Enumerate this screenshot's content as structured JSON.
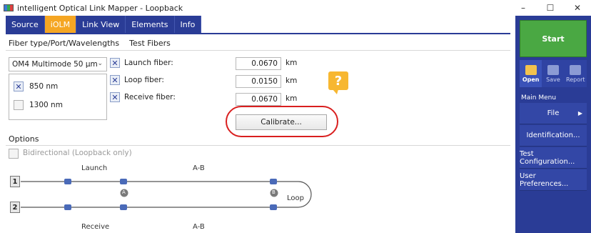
{
  "window": {
    "title": "intelligent Optical Link Mapper - Loopback",
    "controls": {
      "minimize": "–",
      "maximize": "☐",
      "close": "✕"
    }
  },
  "tabs": [
    {
      "label": "Source",
      "active": false
    },
    {
      "label": "iOLM",
      "active": true
    },
    {
      "label": "Link View",
      "active": false
    },
    {
      "label": "Elements",
      "active": false
    },
    {
      "label": "Info",
      "active": false
    }
  ],
  "subtabs": [
    "Fiber type/Port/Wavelengths",
    "Test Fibers"
  ],
  "fiber_type": {
    "selected": "OM4 Multimode 50 µm"
  },
  "wavelengths": [
    {
      "label": "850 nm",
      "checked": true
    },
    {
      "label": "1300 nm",
      "checked": false
    }
  ],
  "test_fibers": [
    {
      "label": "Launch fiber:",
      "checked": true,
      "value": "0.0670",
      "unit": "km"
    },
    {
      "label": "Loop fiber:",
      "checked": true,
      "value": "0.0150",
      "unit": "km"
    },
    {
      "label": "Receive fiber:",
      "checked": true,
      "value": "0.0670",
      "unit": "km"
    }
  ],
  "help": {
    "glyph": "?"
  },
  "calibrate_label": "Calibrate...",
  "options": {
    "heading": "Options",
    "bidirectional": {
      "label": "Bidirectional (Loopback only)",
      "checked": false,
      "enabled": false
    }
  },
  "diagram": {
    "port1": "1",
    "port2": "2",
    "launch": "Launch",
    "receive": "Receive",
    "ab_top": "A-B",
    "ab_bottom": "A-B",
    "point_a": "A",
    "point_b": "B",
    "loop": "Loop"
  },
  "sidebar": {
    "start_label": "Start",
    "tools": [
      {
        "label": "Open",
        "icon": "folder-icon",
        "enabled": true
      },
      {
        "label": "Save",
        "icon": "save-icon",
        "enabled": false
      },
      {
        "label": "Report",
        "icon": "report-icon",
        "enabled": false
      }
    ],
    "menu_heading": "Main Menu",
    "menu": [
      {
        "label": "File",
        "has_submenu": true
      },
      {
        "label": "Identification..."
      },
      {
        "label": "Test Configuration..."
      },
      {
        "label": "User Preferences..."
      }
    ]
  },
  "colors": {
    "accent": "#2a3c96",
    "active_tab": "#f5a623",
    "start": "#4aa843",
    "highlight": "#d91f1f",
    "help": "#f7b731"
  }
}
